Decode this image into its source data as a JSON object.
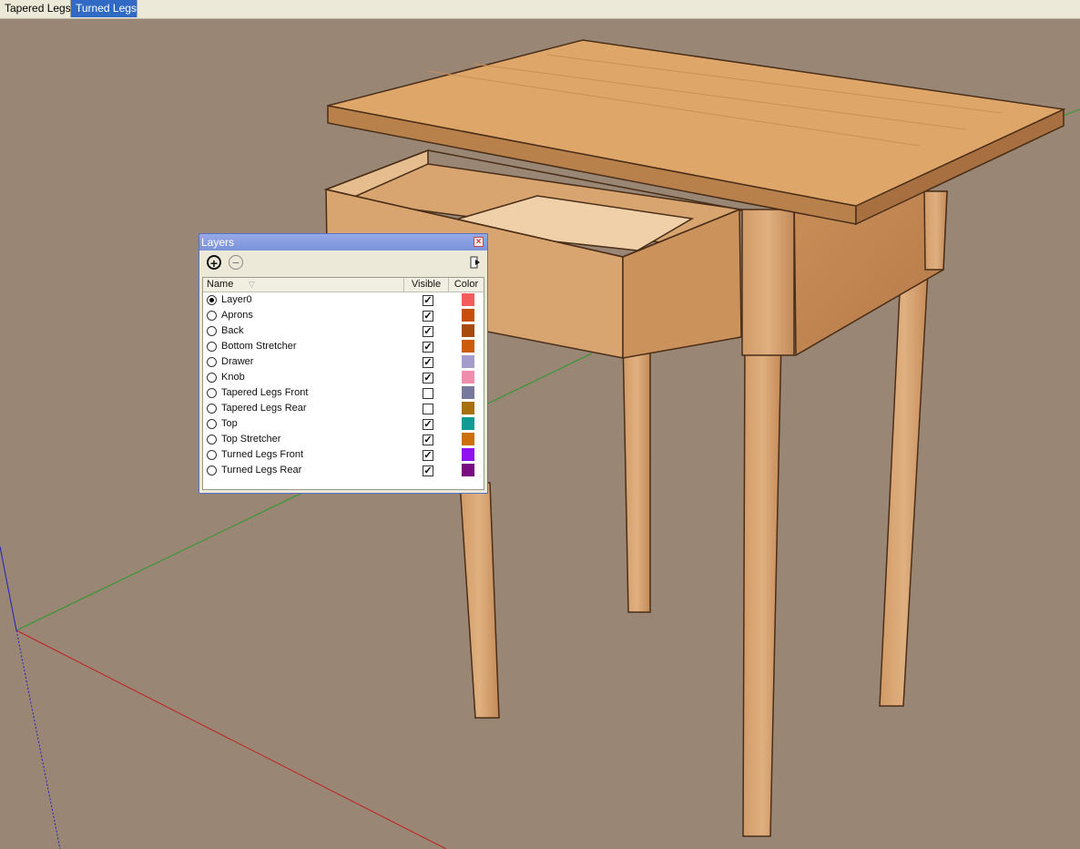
{
  "scene_tabs": [
    {
      "label": "Tapered Legs",
      "active": false
    },
    {
      "label": "Turned Legs",
      "active": true
    }
  ],
  "layers_panel": {
    "title": "Layers",
    "toolbar": {
      "add_icon": "plus-circle-icon",
      "remove_icon": "minus-circle-icon",
      "details_icon": "details-arrow-icon"
    },
    "columns": {
      "name": "Name",
      "visible": "Visible",
      "color": "Color"
    },
    "layers": [
      {
        "name": "Layer0",
        "active": true,
        "visible": true,
        "color": "#f45c5c"
      },
      {
        "name": "Aprons",
        "active": false,
        "visible": true,
        "color": "#c84e0c"
      },
      {
        "name": "Back",
        "active": false,
        "visible": true,
        "color": "#a84a0e"
      },
      {
        "name": "Bottom Stretcher",
        "active": false,
        "visible": true,
        "color": "#cc5c0c"
      },
      {
        "name": "Drawer",
        "active": false,
        "visible": true,
        "color": "#a49ccc"
      },
      {
        "name": "Knob",
        "active": false,
        "visible": true,
        "color": "#f08cac"
      },
      {
        "name": "Tapered Legs Front",
        "active": false,
        "visible": false,
        "color": "#78789c"
      },
      {
        "name": "Tapered Legs Rear",
        "active": false,
        "visible": false,
        "color": "#a8700c"
      },
      {
        "name": "Top",
        "active": false,
        "visible": true,
        "color": "#109c94"
      },
      {
        "name": "Top Stretcher",
        "active": false,
        "visible": true,
        "color": "#cc700c"
      },
      {
        "name": "Turned Legs Front",
        "active": false,
        "visible": true,
        "color": "#9010f0"
      },
      {
        "name": "Turned Legs Rear",
        "active": false,
        "visible": true,
        "color": "#780c80"
      }
    ]
  }
}
